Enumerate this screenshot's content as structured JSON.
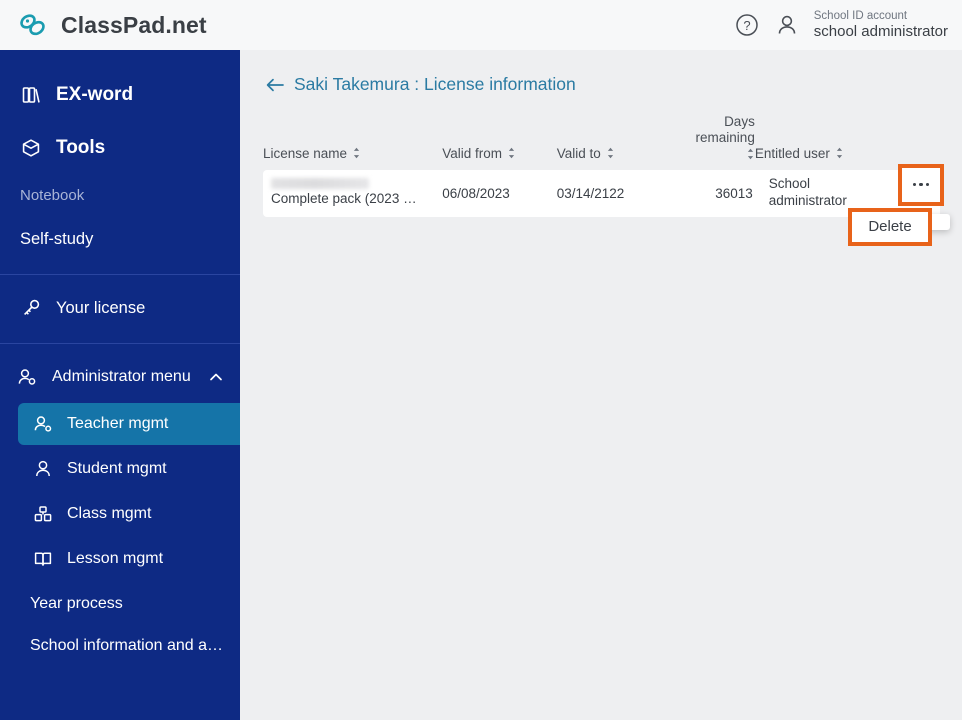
{
  "header": {
    "brand": "ClassPad.net",
    "logo_icon": "chain-link-icon",
    "help_icon": "help-circle-icon",
    "user_icon": "person-icon",
    "account_kind": "School ID account",
    "account_name": "school administrator"
  },
  "sidebar": {
    "top_items": [
      {
        "label": "EX-word",
        "icon": "books-icon",
        "style": "big"
      },
      {
        "label": "Tools",
        "icon": "toolbox-icon",
        "style": "big"
      },
      {
        "label": "Notebook",
        "icon": "",
        "style": "dim"
      },
      {
        "label": "Self-study",
        "icon": "",
        "style": "plain"
      }
    ],
    "license_item": {
      "label": "Your license",
      "icon": "key-icon"
    },
    "admin_group": {
      "label": "Administrator menu",
      "icon": "admin-person-icon",
      "chevron": "chevron-up-icon",
      "expanded": true,
      "items": [
        {
          "label": "Teacher mgmt",
          "icon": "teacher-icon",
          "active": true
        },
        {
          "label": "Student mgmt",
          "icon": "student-icon",
          "active": false
        },
        {
          "label": "Class mgmt",
          "icon": "class-icon",
          "active": false
        },
        {
          "label": "Lesson mgmt",
          "icon": "book-open-icon",
          "active": false
        }
      ],
      "plain_items": [
        {
          "label": "Year process"
        },
        {
          "label": "School information and a…"
        }
      ]
    }
  },
  "main": {
    "back_icon": "arrow-left-icon",
    "page_title": "Saki Takemura : License information",
    "table": {
      "headers": {
        "license_name": "License name",
        "valid_from": "Valid from",
        "valid_to": "Valid to",
        "days_remaining_line1": "Days",
        "days_remaining_line2": "remaining",
        "entitled_user": "Entitled user"
      },
      "sort_icon": "sort-updown-icon",
      "rows": [
        {
          "license_name_redacted": true,
          "license_name": "Complete pack (2023 …",
          "valid_from": "06/08/2023",
          "valid_to": "03/14/2122",
          "days_remaining": "36013",
          "entitled_user": "School administrator",
          "actions_icon": "kebab-menu-icon"
        }
      ]
    },
    "dropdown": {
      "visible": true,
      "items": [
        {
          "label": "Delete",
          "highlighted": true
        }
      ]
    }
  },
  "colors": {
    "sidebar_blue": "#0e2a84",
    "accent_teal": "#1574a8",
    "title_teal": "#2b7ba3",
    "highlight_orange": "#e8631a",
    "content_bg": "#eeeff1",
    "header_bg": "#f7f8f9"
  }
}
